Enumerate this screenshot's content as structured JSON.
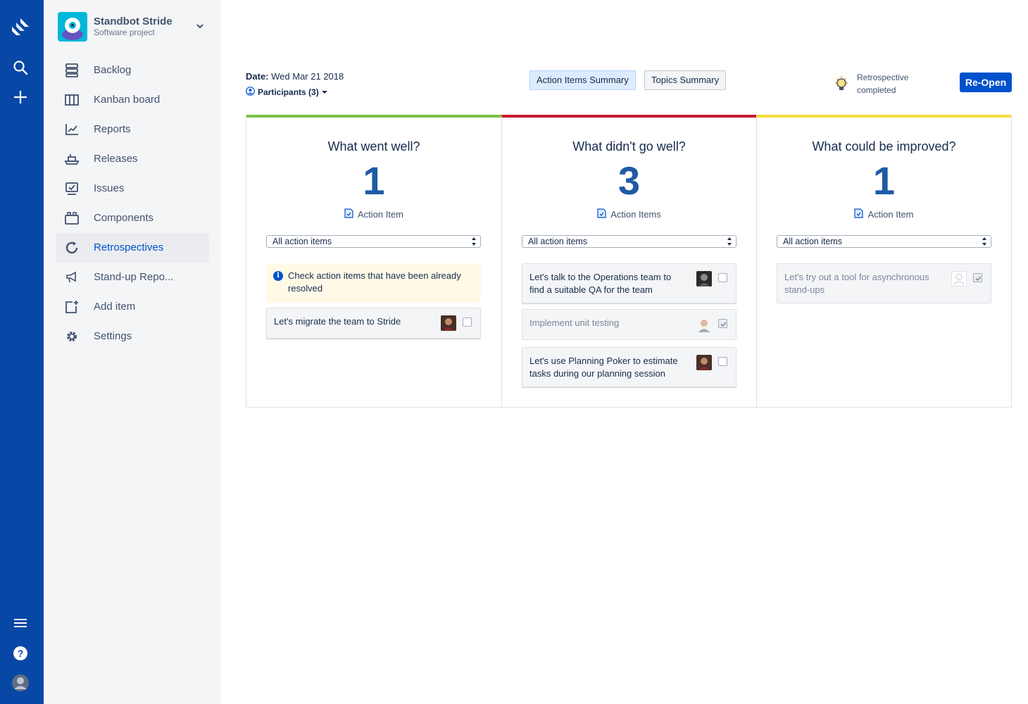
{
  "global_nav": {
    "icons": [
      "jira-software-logo-icon",
      "search-icon",
      "create-plus-icon",
      "menu-icon",
      "help-icon",
      "user-avatar"
    ]
  },
  "project": {
    "name": "Standbot Stride",
    "type": "Software project"
  },
  "sidebar": {
    "items": [
      {
        "label": "Backlog",
        "icon": "backlog-icon"
      },
      {
        "label": "Kanban board",
        "icon": "board-icon"
      },
      {
        "label": "Reports",
        "icon": "reports-icon"
      },
      {
        "label": "Releases",
        "icon": "releases-icon"
      },
      {
        "label": "Issues",
        "icon": "issues-icon"
      },
      {
        "label": "Components",
        "icon": "components-icon"
      },
      {
        "label": "Retrospectives",
        "icon": "retrospectives-icon",
        "active": true
      },
      {
        "label": "Stand-up Repo...",
        "icon": "megaphone-icon"
      },
      {
        "label": "Add item",
        "icon": "add-item-icon"
      },
      {
        "label": "Settings",
        "icon": "gear-icon"
      }
    ]
  },
  "header": {
    "date_label": "Date:",
    "date_value": "Wed Mar 21 2018",
    "participants": "Participants (3)",
    "tabs": [
      "Action Items Summary",
      "Topics Summary"
    ],
    "status_line1": "Retrospective",
    "status_line2": "completed",
    "reopen": "Re-Open"
  },
  "columns": [
    {
      "title": "What went well?",
      "count": "1",
      "ai_label": "Action Item",
      "filter": "All action items",
      "accent": "#7ac143",
      "info": "Check action items that have been already resolved",
      "cards": [
        {
          "text": "Let's migrate the team to Stride",
          "done": false
        }
      ]
    },
    {
      "title": "What didn't go well?",
      "count": "3",
      "ai_label": "Action Items",
      "filter": "All action items",
      "accent": "#c9192c",
      "cards": [
        {
          "text": "Let's talk to the Operations team to find a suitable QA for the team",
          "done": false
        },
        {
          "text": "Implement unit testing",
          "done": true
        },
        {
          "text": "Let's use Planning Poker to estimate tasks during our planning session",
          "done": false
        }
      ]
    },
    {
      "title": "What could be improved?",
      "count": "1",
      "ai_label": "Action Item",
      "filter": "All action items",
      "accent": "#f2de3a",
      "cards": [
        {
          "text": "Let's try out a tool for asynchronous stand-ups",
          "done": true
        }
      ]
    }
  ],
  "colors": {
    "global_nav": "#0747a6",
    "sidebar_bg": "#f4f5f7",
    "primary": "#0052cc",
    "count": "#1e5aa6",
    "info_bg": "#fffae6"
  }
}
